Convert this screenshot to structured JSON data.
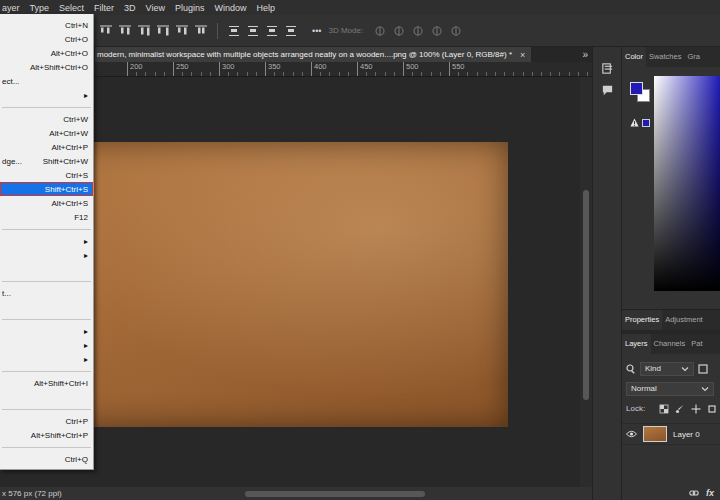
{
  "window": {
    "title": "Photoshop"
  },
  "menubar": {
    "items": [
      "ayer",
      "Type",
      "Select",
      "Filter",
      "3D",
      "View",
      "Plugins",
      "Window",
      "Help"
    ]
  },
  "file_menu": {
    "items": [
      {
        "kind": "item",
        "label": "",
        "shortcut": "Ctrl+N",
        "arrow": "",
        "selected": false
      },
      {
        "kind": "item",
        "label": "",
        "shortcut": "Ctrl+O",
        "arrow": "",
        "selected": false
      },
      {
        "kind": "item",
        "label": "",
        "shortcut": "Alt+Ctrl+O",
        "arrow": "",
        "selected": false
      },
      {
        "kind": "item",
        "label": "",
        "shortcut": "Alt+Shift+Ctrl+O",
        "arrow": "",
        "selected": false
      },
      {
        "kind": "item",
        "label": "ect...",
        "shortcut": "",
        "arrow": "",
        "selected": false
      },
      {
        "kind": "item",
        "label": "",
        "shortcut": "",
        "arrow": "▸",
        "selected": false
      },
      {
        "kind": "separator"
      },
      {
        "kind": "item",
        "label": "",
        "shortcut": "Ctrl+W",
        "arrow": "",
        "selected": false
      },
      {
        "kind": "item",
        "label": "",
        "shortcut": "Alt+Ctrl+W",
        "arrow": "",
        "selected": false
      },
      {
        "kind": "item",
        "label": "",
        "shortcut": "Alt+Ctrl+P",
        "arrow": "",
        "selected": false
      },
      {
        "kind": "item",
        "label": "dge...",
        "shortcut": "Shift+Ctrl+W",
        "arrow": "",
        "selected": false
      },
      {
        "kind": "item",
        "label": "",
        "shortcut": "Ctrl+S",
        "arrow": "",
        "selected": false
      },
      {
        "kind": "item",
        "label": "",
        "shortcut": "Shift+Ctrl+S",
        "arrow": "",
        "selected": true
      },
      {
        "kind": "item",
        "label": "",
        "shortcut": "Alt+Ctrl+S",
        "arrow": "",
        "selected": false
      },
      {
        "kind": "item",
        "label": "",
        "shortcut": "F12",
        "arrow": "",
        "selected": false
      },
      {
        "kind": "separator"
      },
      {
        "kind": "item",
        "label": "",
        "shortcut": "",
        "arrow": "▸",
        "selected": false
      },
      {
        "kind": "item",
        "label": "",
        "shortcut": "",
        "arrow": "▸",
        "selected": false
      },
      {
        "kind": "item",
        "label": "",
        "shortcut": "",
        "arrow": "",
        "selected": false
      },
      {
        "kind": "separator"
      },
      {
        "kind": "item",
        "label": "t...",
        "shortcut": "",
        "arrow": "",
        "selected": false
      },
      {
        "kind": "item",
        "label": "",
        "shortcut": "",
        "arrow": "",
        "selected": false
      },
      {
        "kind": "separator"
      },
      {
        "kind": "item",
        "label": "",
        "shortcut": "",
        "arrow": "▸",
        "selected": false
      },
      {
        "kind": "item",
        "label": "",
        "shortcut": "",
        "arrow": "▸",
        "selected": false
      },
      {
        "kind": "item",
        "label": "",
        "shortcut": "",
        "arrow": "▸",
        "selected": false
      },
      {
        "kind": "separator"
      },
      {
        "kind": "item",
        "label": "",
        "shortcut": "Alt+Shift+Ctrl+I",
        "arrow": "",
        "selected": false
      },
      {
        "kind": "item",
        "label": "",
        "shortcut": "",
        "arrow": "",
        "selected": false
      },
      {
        "kind": "separator"
      },
      {
        "kind": "item",
        "label": "",
        "shortcut": "Ctrl+P",
        "arrow": "",
        "selected": false
      },
      {
        "kind": "item",
        "label": "",
        "shortcut": "Alt+Shift+Ctrl+P",
        "arrow": "",
        "selected": false
      },
      {
        "kind": "separator"
      },
      {
        "kind": "item",
        "label": "",
        "shortcut": "Ctrl+Q",
        "arrow": "",
        "selected": false
      }
    ]
  },
  "options_bar": {
    "more": "•••",
    "mode_label": "3D Mode:"
  },
  "document_tab": {
    "title": "modern, minimalist workspace with multiple objects arranged neatly on a wooden....png @ 100% (Layer 0, RGB/8#) *",
    "close": "×",
    "collapse": "»"
  },
  "ruler": {
    "ticks": [
      "200",
      "250",
      "300",
      "350",
      "400",
      "450",
      "500",
      "550"
    ]
  },
  "color_panel": {
    "tabs": [
      {
        "label": "Color",
        "selected": true
      },
      {
        "label": "Swatches",
        "selected": false
      },
      {
        "label": "Gra",
        "selected": false
      }
    ],
    "foreground": "#1f1ab8",
    "background": "#ffffff"
  },
  "properties_panel": {
    "tabs": [
      {
        "label": "Properties",
        "selected": true
      },
      {
        "label": "Adjustment",
        "selected": false
      }
    ]
  },
  "layers_panel": {
    "tabs": [
      {
        "label": "Layers",
        "selected": true
      },
      {
        "label": "Channels",
        "selected": false
      },
      {
        "label": "Pat",
        "selected": false
      }
    ],
    "filter": "Kind",
    "blend_mode": "Normal",
    "lock_label": "Lock:",
    "layers": [
      {
        "name": "Layer 0",
        "visible": true,
        "selected": false
      }
    ],
    "footer": [
      "fx"
    ]
  },
  "status_bar": {
    "text": "x 576 px (72 ppi)"
  }
}
